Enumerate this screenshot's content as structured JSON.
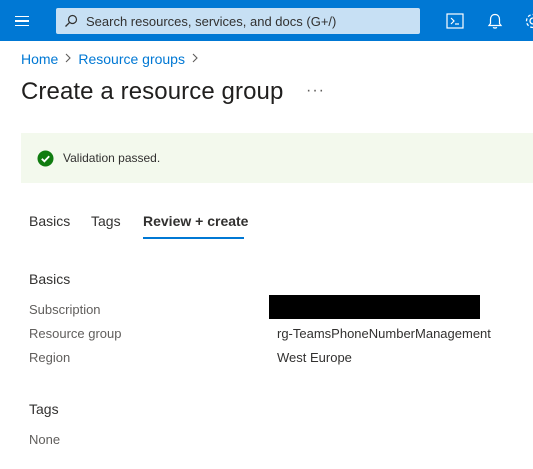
{
  "topbar": {
    "search_placeholder": "Search resources, services, and docs (G+/)",
    "icons": [
      "menu-icon",
      "search-icon",
      "cloud-shell-icon",
      "notifications-bell-icon",
      "settings-gear-icon"
    ]
  },
  "breadcrumb": {
    "items": [
      "Home",
      "Resource groups"
    ]
  },
  "page": {
    "title": "Create a resource group",
    "more": "···"
  },
  "banner": {
    "text": "Validation passed.",
    "status_color": "#107c10"
  },
  "tabs": {
    "items": [
      "Basics",
      "Tags",
      "Review + create"
    ],
    "active": "Review + create"
  },
  "basics": {
    "heading": "Basics",
    "rows": [
      {
        "label": "Subscription",
        "value": ""
      },
      {
        "label": "Resource group",
        "value": "rg-TeamsPhoneNumberManagement"
      },
      {
        "label": "Region",
        "value": "West Europe"
      }
    ]
  },
  "tags": {
    "heading": "Tags",
    "value": "None"
  },
  "colors": {
    "brand": "#0078d4",
    "banner_bg": "#f3f9ed"
  }
}
